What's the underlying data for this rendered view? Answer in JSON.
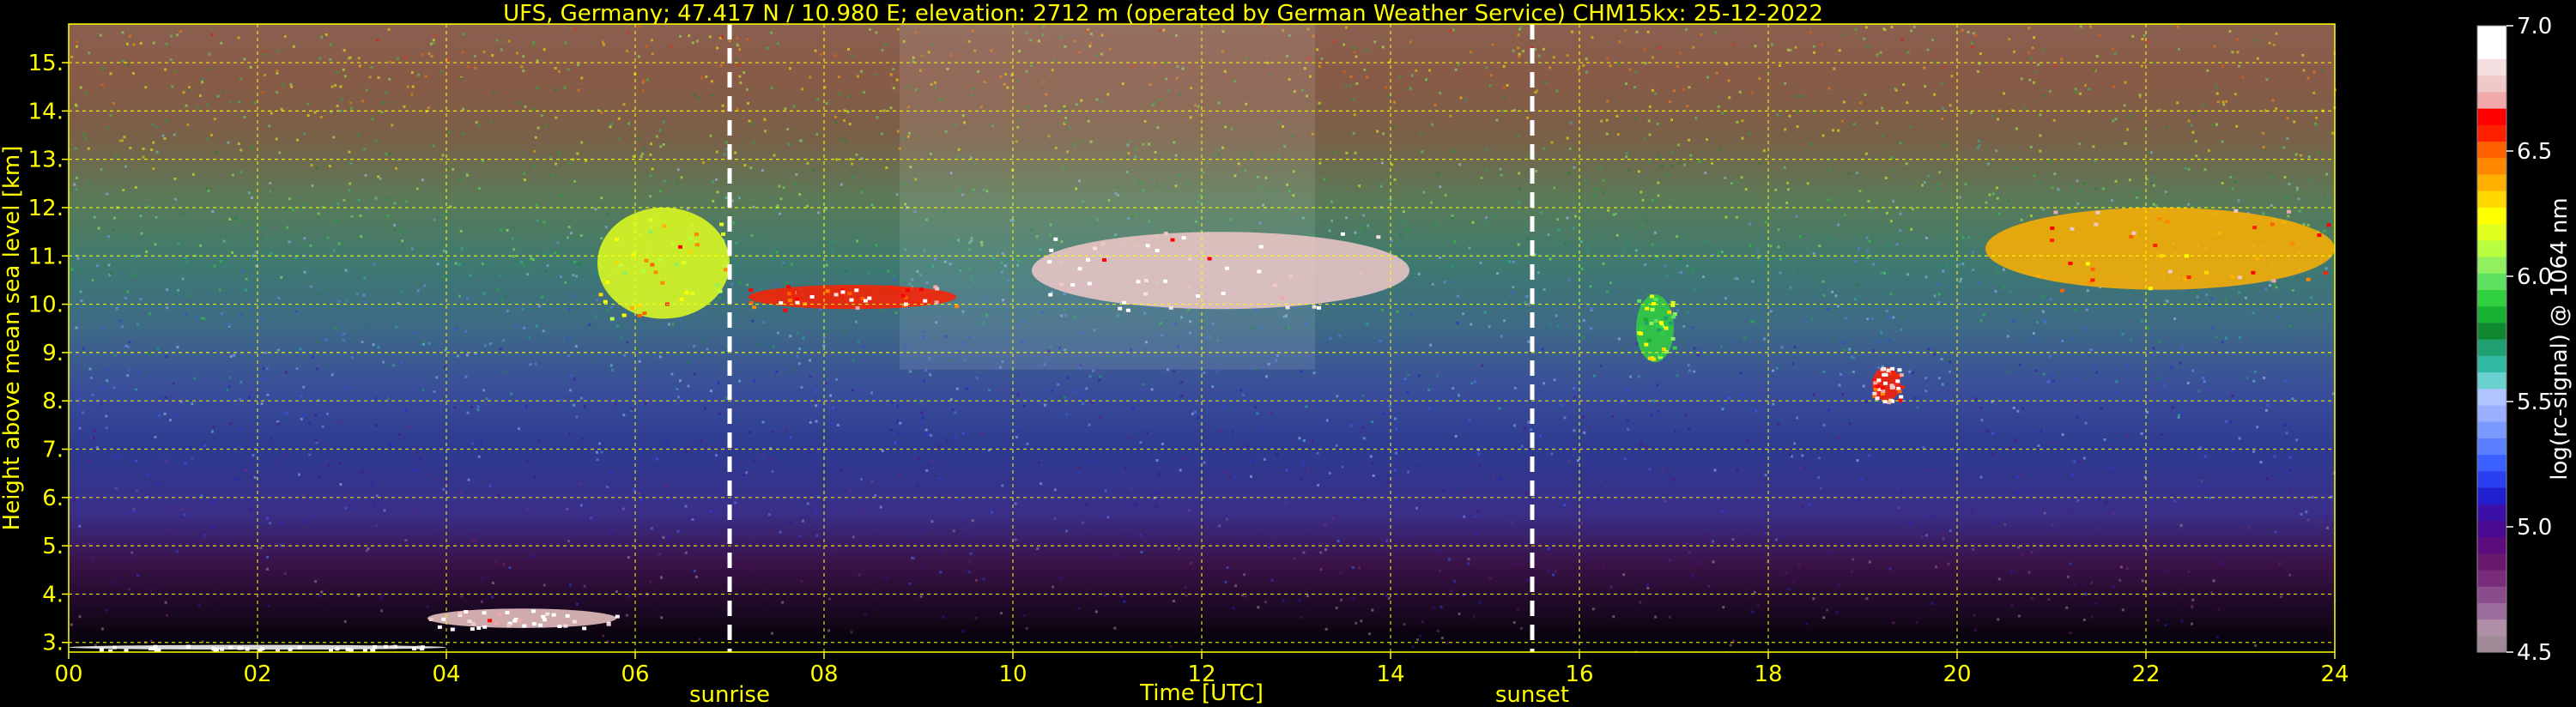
{
  "chart_data": {
    "type": "heatmap",
    "title": "UFS, Germany; 47.417 N / 10.980 E; elevation: 2712 m  (operated by German Weather Service)    CHM15kx: 25-12-2022",
    "xlabel": "Time [UTC]",
    "ylabel": "Height above mean sea level [km]",
    "xlim": [
      0,
      24
    ],
    "ylim": [
      2.8,
      15.8
    ],
    "x_ticks": [
      "00",
      "02",
      "04",
      "06",
      "08",
      "10",
      "12",
      "14",
      "16",
      "18",
      "20",
      "22",
      "24"
    ],
    "y_ticks": [
      "3.",
      "4.",
      "5.",
      "6.",
      "7.",
      "8.",
      "9.",
      "10.",
      "11.",
      "12.",
      "13.",
      "14.",
      "15."
    ],
    "grid": true,
    "markers": [
      {
        "label": "sunrise",
        "x": 7.0
      },
      {
        "label": "sunset",
        "x": 15.5
      }
    ],
    "colorbar": {
      "label": "log(rc-signal) @ 1064 nm",
      "range": [
        4.5,
        7.0
      ],
      "ticks": [
        "4.5",
        "5.0",
        "5.5",
        "6.0",
        "6.5",
        "7.0"
      ],
      "colors": [
        "#a08a98",
        "#b090a8",
        "#9c6c9c",
        "#8a4c8c",
        "#7a2c7c",
        "#6a1a6e",
        "#5c0c7c",
        "#4a0a90",
        "#3a10a8",
        "#2020d0",
        "#2a40f0",
        "#3a60ff",
        "#5a80ff",
        "#7a9aff",
        "#9ab0ff",
        "#b0c4ff",
        "#6ad0d0",
        "#30b8a0",
        "#20a070",
        "#108830",
        "#18b030",
        "#30d040",
        "#60e060",
        "#90f060",
        "#b8ff40",
        "#e0ff20",
        "#ffff00",
        "#ffd800",
        "#ffb000",
        "#ff8800",
        "#ff6000",
        "#ff2000",
        "#ff0000",
        "#f0a8a8",
        "#f0c8c8",
        "#f4e0e0",
        "#ffffff",
        "#ffffff"
      ]
    },
    "cloud_features": [
      {
        "t0": 0.0,
        "t1": 4.0,
        "h0": 2.85,
        "h1": 2.95,
        "value": 7.0
      },
      {
        "t0": 3.8,
        "t1": 5.8,
        "h0": 3.3,
        "h1": 3.7,
        "value": 6.8
      },
      {
        "t0": 5.6,
        "t1": 7.0,
        "h0": 9.7,
        "h1": 12.0,
        "value": 6.2
      },
      {
        "t0": 7.2,
        "t1": 9.4,
        "h0": 9.9,
        "h1": 10.4,
        "value": 6.6
      },
      {
        "t0": 10.2,
        "t1": 14.2,
        "h0": 9.9,
        "h1": 11.5,
        "value": 6.8
      },
      {
        "t0": 16.6,
        "t1": 17.0,
        "h0": 8.8,
        "h1": 10.2,
        "value": 5.9
      },
      {
        "t0": 19.1,
        "t1": 19.4,
        "h0": 8.0,
        "h1": 8.7,
        "value": 6.6
      },
      {
        "t0": 20.3,
        "t1": 24.0,
        "h0": 10.3,
        "h1": 12.0,
        "value": 6.4
      }
    ]
  }
}
